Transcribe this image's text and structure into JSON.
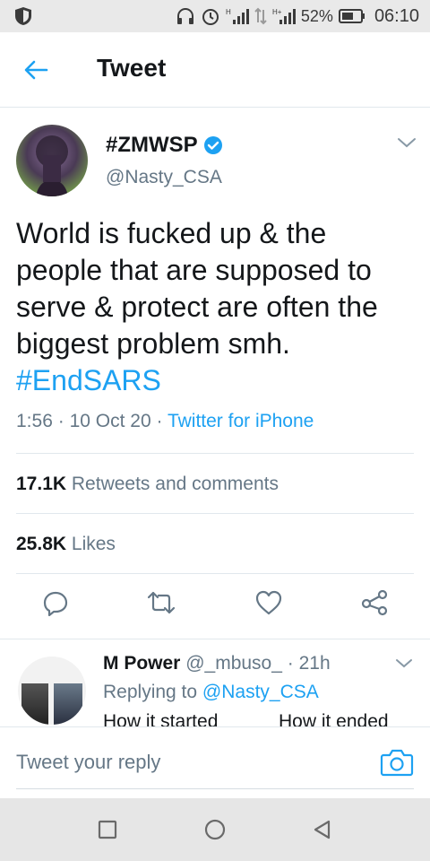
{
  "status_bar": {
    "battery_percent": "52%",
    "time": "06:10",
    "icons": [
      "shield-icon",
      "headphones-icon",
      "alarm-icon",
      "signal-icon",
      "data-transfer-icon",
      "signal-icon",
      "battery-icon"
    ]
  },
  "header": {
    "title": "Tweet",
    "back_icon": "arrow-left-icon"
  },
  "tweet": {
    "display_name": "#ZMWSP",
    "verified": true,
    "handle": "@Nasty_CSA",
    "text": "World is fucked up & the people that are supposed to serve & protect are often the biggest problem smh.",
    "hashtag": "#EndSARS",
    "time": "1:56",
    "date": "10 Oct 20",
    "separator": "·",
    "source": "Twitter for iPhone",
    "retweets_count": "17.1K",
    "retweets_label": "Retweets and comments",
    "likes_count": "25.8K",
    "likes_label": "Likes"
  },
  "actions": [
    "reply-icon",
    "retweet-icon",
    "like-icon",
    "share-icon"
  ],
  "reply": {
    "name": "M Power",
    "handle": "@_mbuso_",
    "separator": "·",
    "time": "21h",
    "replying_label": "Replying to",
    "replying_handle": "@Nasty_CSA",
    "snippet_left": "How it started",
    "snippet_right": "How it ended"
  },
  "compose": {
    "placeholder": "Tweet your reply",
    "camera_icon": "camera-icon"
  },
  "colors": {
    "accent": "#1da1f2",
    "secondary_text": "#657786",
    "primary_text": "#14171a",
    "divider": "#e1e8ed"
  }
}
